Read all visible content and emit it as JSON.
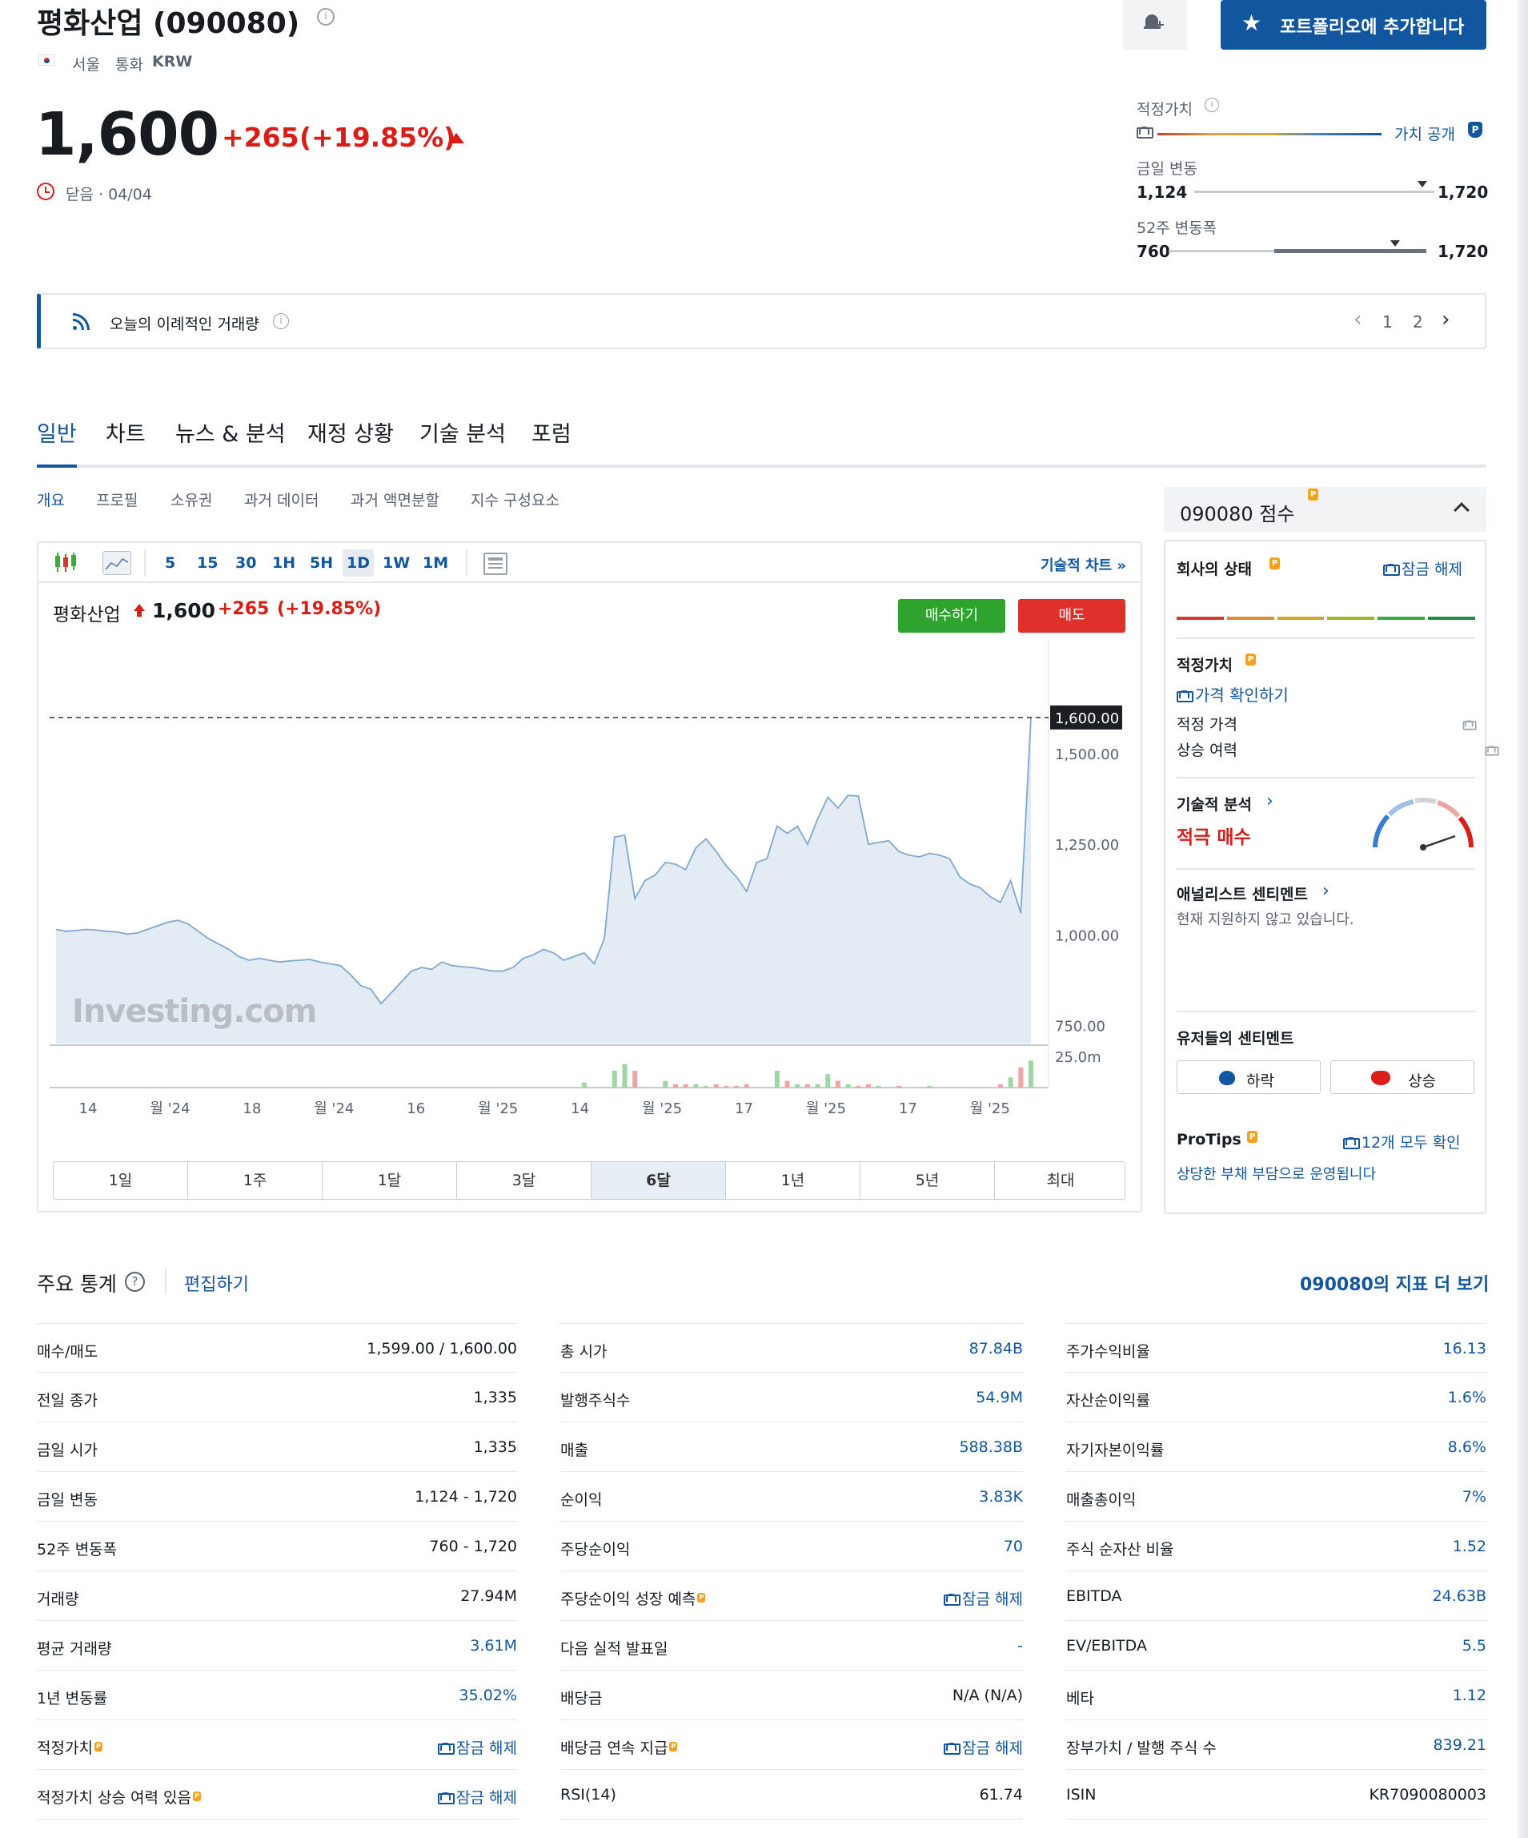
{
  "header": {
    "title": "평화산업 (090080)",
    "exchange": "서울",
    "currency_label": "통화",
    "currency": "KRW",
    "price": "1,600",
    "change": "+265",
    "change_pct": "(+19.85%)",
    "status": "닫음 · 04/04",
    "add_portfolio": "포트폴리오에 추가합니다"
  },
  "ranges": {
    "fair_value_label": "적정가치",
    "fair_value_link": "가치 공개",
    "day_label": "금일 변동",
    "day_low": "1,124",
    "day_high": "1,720",
    "day_marker": 0.95,
    "week52_label": "52주 변동폭",
    "week52_low": "760",
    "week52_high": "1,720",
    "week52_marker": 0.88
  },
  "banner": {
    "text": "오늘의 이례적인 거래량",
    "page1": "1",
    "page2": "2"
  },
  "tabs": [
    "일반",
    "차트",
    "뉴스 & 분석",
    "재정 상황",
    "기술 분석",
    "포럼"
  ],
  "subtabs": [
    "개요",
    "프로필",
    "소유권",
    "과거 데이터",
    "과거 액면분할",
    "지수 구성요소"
  ],
  "chart_toolbar": {
    "timeframes": [
      "5",
      "15",
      "30",
      "1H",
      "5H",
      "1D",
      "1W",
      "1M"
    ],
    "technical_link": "기술적 차트 »"
  },
  "chart_header": {
    "name": "평화산업",
    "price": "1,600",
    "change": "+265",
    "change_pct": "(+19.85%)",
    "buy": "매수하기",
    "sell": "매도"
  },
  "chart_data": {
    "type": "area",
    "title": "",
    "ylim": [
      700,
      1750
    ],
    "yticks": [
      "1,500.00",
      "1,250.00",
      "1,000.00",
      "750.00"
    ],
    "last_label": "1,600.00",
    "volume_tick": "25.0m",
    "xticks": [
      "14",
      "월 '24",
      "18",
      "월 '24",
      "16",
      "월 '25",
      "14",
      "월 '25",
      "17",
      "월 '25",
      "17",
      "월 '25"
    ],
    "series": [
      {
        "values": [
          1015,
          1010,
          1012,
          1015,
          1013,
          1010,
          1008,
          1002,
          1005,
          1015,
          1025,
          1035,
          1040,
          1030,
          1010,
          990,
          975,
          960,
          940,
          930,
          935,
          930,
          925,
          928,
          930,
          932,
          925,
          920,
          915,
          890,
          860,
          850,
          810,
          840,
          870,
          900,
          910,
          905,
          925,
          915,
          912,
          910,
          905,
          900,
          900,
          910,
          935,
          945,
          960,
          950,
          930,
          940,
          950,
          920,
          990,
          1270,
          1275,
          1100,
          1150,
          1165,
          1200,
          1195,
          1180,
          1240,
          1265,
          1230,
          1190,
          1160,
          1120,
          1200,
          1210,
          1300,
          1280,
          1300,
          1250,
          1320,
          1380,
          1350,
          1385,
          1383,
          1250,
          1255,
          1260,
          1230,
          1220,
          1215,
          1225,
          1220,
          1210,
          1160,
          1140,
          1130,
          1105,
          1090,
          1150,
          1060,
          1600
        ]
      },
      {
        "name": "volume",
        "values": [
          0,
          0,
          0,
          0,
          0,
          0,
          0,
          0,
          0,
          0,
          0,
          0,
          0,
          0,
          0,
          0,
          0,
          0,
          0,
          0,
          0,
          0,
          0,
          0,
          0,
          0,
          0,
          0,
          0,
          0,
          0,
          0,
          0,
          0,
          0,
          0,
          0,
          0,
          0,
          0,
          0,
          0,
          0,
          0,
          0,
          0,
          0,
          0,
          0,
          0,
          0,
          0,
          1.5,
          0,
          0,
          5,
          7,
          5,
          0,
          0,
          2,
          1,
          1,
          1,
          0.5,
          1,
          0.5,
          0.5,
          1,
          0,
          0,
          5,
          2,
          1,
          1,
          1,
          4,
          2,
          1,
          0.5,
          1,
          0.5,
          0,
          0.5,
          0,
          0,
          0.5,
          0,
          0,
          0,
          0,
          0,
          0,
          1,
          3,
          6,
          8
        ]
      }
    ],
    "ranges": [
      "1일",
      "1주",
      "1달",
      "3달",
      "6달",
      "1년",
      "5년",
      "최대"
    ],
    "selected_range": "6달",
    "watermark": "Investing.com"
  },
  "sidebar": {
    "score_title": "090080 점수",
    "health_label": "회사의 상태",
    "unlock": "잠금 해제",
    "health_colors": [
      "#d23b2b",
      "#e28c33",
      "#cfa72a",
      "#99b92b",
      "#3aab3b",
      "#1f9041"
    ],
    "fair_value_label": "적정가치",
    "check_price": "가격 확인하기",
    "fair_price": "적정 가격",
    "upside": "상승 여력",
    "tech_label": "기술적 분석",
    "tech_value": "적극 매수",
    "analyst_label": "애널리스트 센티멘트",
    "analyst_text": "현재 지원하지 않고 있습니다.",
    "user_sent_label": "유저들의 센티멘트",
    "bear": "하락",
    "bull": "상승",
    "protips": "ProTips",
    "protips_link": "12개 모두 확인",
    "protips_text": "상당한 부채 부담으로 운영됩니다"
  },
  "stats": {
    "title": "주요 통계",
    "edit": "편집하기",
    "more": "090080의 지표 더 보기",
    "col1": [
      {
        "k": "매수/매도",
        "v": "1,599.00  /  1,600.00"
      },
      {
        "k": "전일 종가",
        "v": "1,335"
      },
      {
        "k": "금일 시가",
        "v": "1,335"
      },
      {
        "k": "금일 변동",
        "v": "1,124 - 1,720"
      },
      {
        "k": "52주 변동폭",
        "v": "760 - 1,720"
      },
      {
        "k": "거래량",
        "v": "27.94M"
      },
      {
        "k": "평균 거래량",
        "v": "3.61M"
      },
      {
        "k": "1년 변동률",
        "v": "35.02%"
      },
      {
        "k": "적정가치",
        "v": "잠금 해제"
      },
      {
        "k": "적정가치 상승 여력 있음",
        "v": "잠금 해제"
      }
    ],
    "col2": [
      {
        "k": "총 시가",
        "v": "87.84B"
      },
      {
        "k": "발행주식수",
        "v": "54.9M"
      },
      {
        "k": "매출",
        "v": "588.38B"
      },
      {
        "k": "순이익",
        "v": "3.83K"
      },
      {
        "k": "주당순이익",
        "v": "70"
      },
      {
        "k": "주당순이익 성장 예측",
        "v": "잠금 해제"
      },
      {
        "k": "다음 실적 발표일",
        "v": "-"
      },
      {
        "k": "배당금",
        "v": "N/A (N/A)"
      },
      {
        "k": "배당금 연속 지급",
        "v": "잠금 해제"
      },
      {
        "k": "RSI(14)",
        "v": "61.74"
      }
    ],
    "col3": [
      {
        "k": "주가수익비율",
        "v": "16.13"
      },
      {
        "k": "자산순이익률",
        "v": "1.6%"
      },
      {
        "k": "자기자본이익률",
        "v": "8.6%"
      },
      {
        "k": "매출총이익",
        "v": "7%"
      },
      {
        "k": "주식 순자산 비율",
        "v": "1.52"
      },
      {
        "k": "EBITDA",
        "v": "24.63B"
      },
      {
        "k": "EV/EBITDA",
        "v": "5.5"
      },
      {
        "k": "베타",
        "v": "1.12"
      },
      {
        "k": "장부가치 / 발행 주식 수",
        "v": "839.21"
      },
      {
        "k": "ISIN",
        "v": "KR7090080003"
      }
    ]
  }
}
